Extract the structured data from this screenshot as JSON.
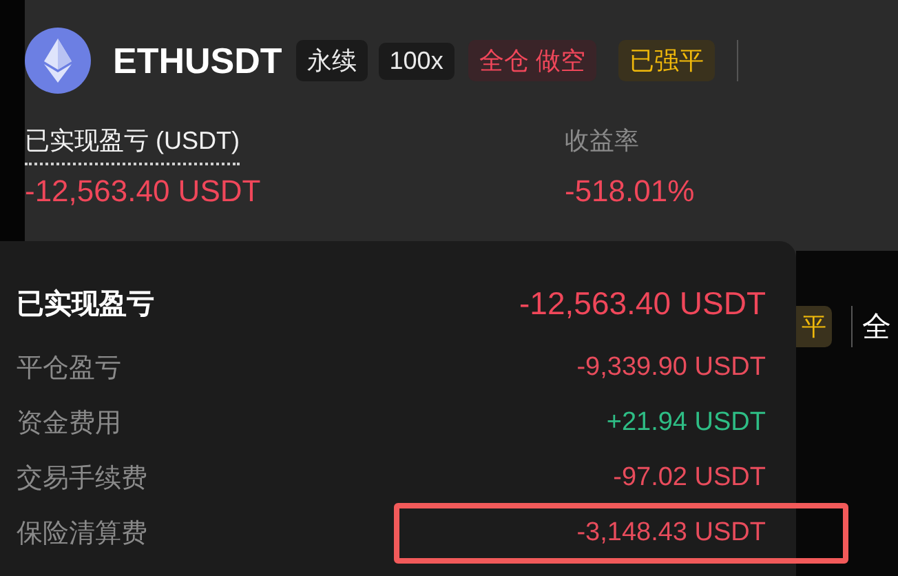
{
  "header": {
    "symbol": "ETHUSDT",
    "tags": [
      {
        "label": "永续",
        "kind": "neutral"
      },
      {
        "label": "100x",
        "kind": "neutral"
      },
      {
        "label": "全仓 做空",
        "kind": "short"
      },
      {
        "label": "已强平",
        "kind": "warning"
      }
    ]
  },
  "stats": [
    {
      "label": "已实现盈亏 (USDT)",
      "value": "-12,563.40 USDT",
      "underlined": true
    },
    {
      "label": "收益率",
      "value": "-518.01%",
      "underlined": false
    }
  ],
  "background_row": {
    "tag": "平",
    "text": "全"
  },
  "tooltip": {
    "title": "已实现盈亏",
    "total": "-12,563.40 USDT",
    "rows": [
      {
        "label": "平仓盈亏",
        "value": "-9,339.90 USDT",
        "color": "#e84c5c",
        "highlighted": false
      },
      {
        "label": "资金费用",
        "value": "+21.94 USDT",
        "color": "#2ebd85",
        "highlighted": false
      },
      {
        "label": "交易手续费",
        "value": "-97.02 USDT",
        "color": "#e84c5c",
        "highlighted": false
      },
      {
        "label": "保险清算费",
        "value": "-3,148.43 USDT",
        "color": "#e84c5c",
        "highlighted": true
      }
    ]
  }
}
